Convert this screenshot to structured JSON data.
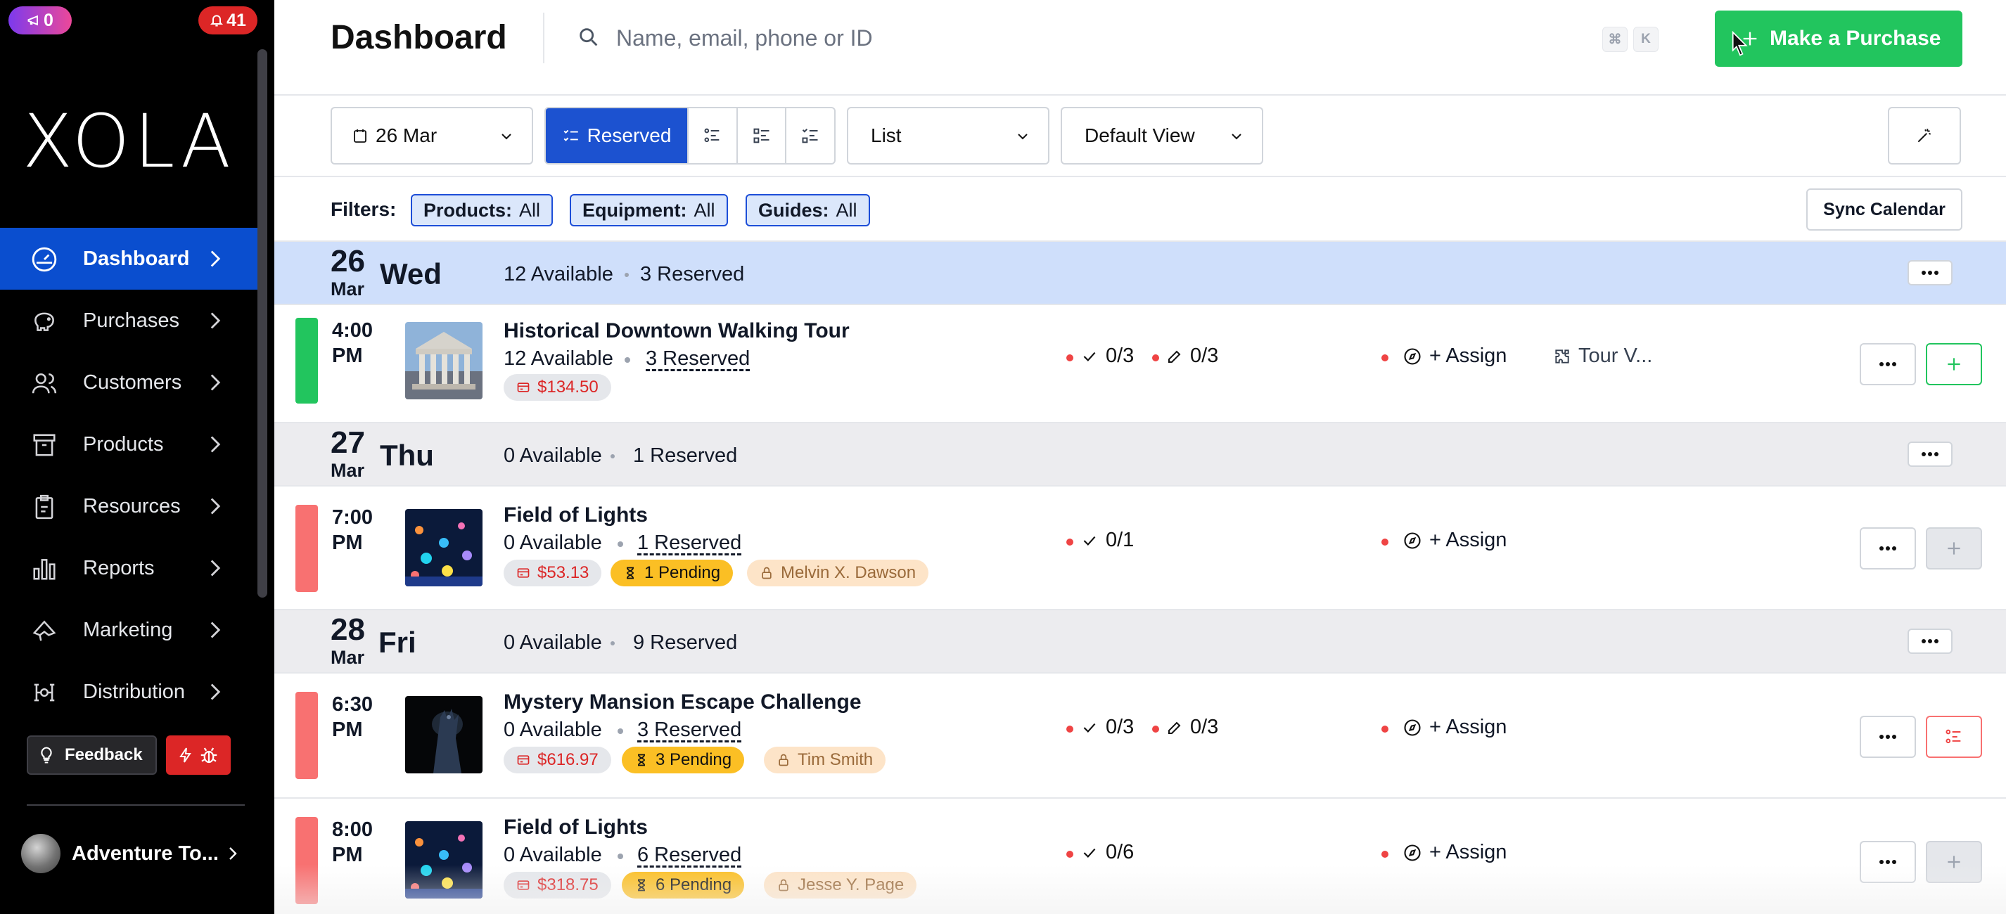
{
  "sidebar": {
    "points_badge": "0",
    "alerts_badge": "41",
    "logo": "XOLA",
    "nav": [
      {
        "label": "Dashboard",
        "icon": "dashboard-icon",
        "active": true
      },
      {
        "label": "Purchases",
        "icon": "piggy-bank-icon"
      },
      {
        "label": "Customers",
        "icon": "users-icon"
      },
      {
        "label": "Products",
        "icon": "archive-box-icon"
      },
      {
        "label": "Resources",
        "icon": "clipboard-icon"
      },
      {
        "label": "Reports",
        "icon": "bar-chart-icon"
      },
      {
        "label": "Marketing",
        "icon": "megaphone-icon"
      },
      {
        "label": "Distribution",
        "icon": "network-icon"
      }
    ],
    "feedback_label": "Feedback",
    "account_name": "Adventure To..."
  },
  "header": {
    "title": "Dashboard",
    "search_placeholder": "Name, email, phone or ID",
    "kbd_cmd": "⌘",
    "kbd_k": "K",
    "purchase_label": "Make a Purchase"
  },
  "toolbar": {
    "date": "26 Mar",
    "reserved_label": "Reserved",
    "list_label": "List",
    "view_label": "Default View"
  },
  "filters": {
    "label": "Filters:",
    "chips": [
      {
        "name": "Products:",
        "value": "All"
      },
      {
        "name": "Equipment:",
        "value": "All"
      },
      {
        "name": "Guides:",
        "value": "All"
      }
    ],
    "sync_label": "Sync Calendar"
  },
  "days": [
    {
      "num": "26",
      "month": "Mar",
      "weekday": "Wed",
      "available": "12 Available",
      "reserved": "3 Reserved"
    },
    {
      "num": "27",
      "month": "Mar",
      "weekday": "Thu",
      "available": "0 Available",
      "reserved": "1 Reserved"
    },
    {
      "num": "28",
      "month": "Mar",
      "weekday": "Fri",
      "available": "0 Available",
      "reserved": "9 Reserved"
    }
  ],
  "events": [
    {
      "time_h": "4:00",
      "time_p": "PM",
      "title": "Historical Downtown Walking Tour",
      "available": "12 Available",
      "reserved": "3 Reserved",
      "price": "$134.50",
      "checkin": "0/3",
      "waiver": "0/3",
      "assign": "+ Assign",
      "tour_v": "Tour V...",
      "status_color": "#22c55e"
    },
    {
      "time_h": "7:00",
      "time_p": "PM",
      "title": "Field of Lights",
      "available": "0 Available",
      "reserved": "1 Reserved",
      "price": "$53.13",
      "pending": "1 Pending",
      "guide": "Melvin X. Dawson",
      "checkin": "0/1",
      "assign": "+ Assign",
      "status_color": "#f87171"
    },
    {
      "time_h": "6:30",
      "time_p": "PM",
      "title": "Mystery Mansion Escape Challenge",
      "available": "0 Available",
      "reserved": "3 Reserved",
      "price": "$616.97",
      "pending": "3 Pending",
      "guide": "Tim Smith",
      "checkin": "0/3",
      "waiver": "0/3",
      "assign": "+ Assign",
      "status_color": "#f87171"
    },
    {
      "time_h": "8:00",
      "time_p": "PM",
      "title": "Field of Lights",
      "available": "0 Available",
      "reserved": "6 Reserved",
      "price": "$318.75",
      "pending": "6 Pending",
      "guide": "Jesse Y. Page",
      "checkin": "0/6",
      "assign": "+ Assign",
      "status_color": "#f87171"
    }
  ],
  "colors": {
    "accent": "#1c52d0",
    "success": "#22c55e",
    "danger": "#ef4444",
    "pending": "#fbbf24"
  }
}
